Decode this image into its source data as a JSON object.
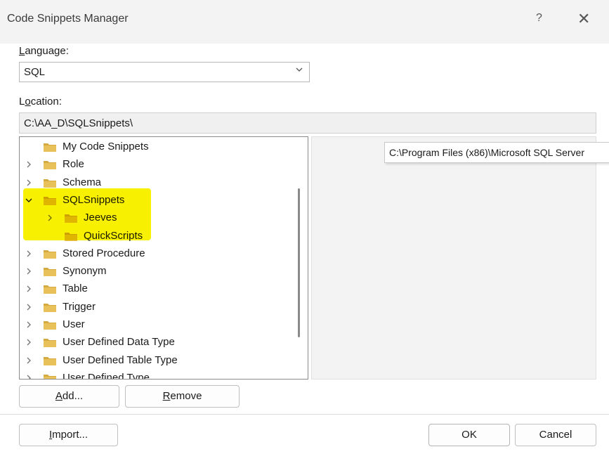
{
  "window": {
    "title": "Code Snippets Manager",
    "help": "?",
    "close": "✕"
  },
  "language": {
    "label": "Language:",
    "mnemonic": "L",
    "rest": "anguage:",
    "value": "SQL"
  },
  "location": {
    "label": "Location:",
    "pre": "L",
    "mnemonic": "o",
    "rest": "cation:",
    "value": "C:\\AA_D\\SQLSnippets\\"
  },
  "tree": {
    "items": [
      {
        "label": "My Code Snippets",
        "level": 1,
        "arrow": "none"
      },
      {
        "label": "Role",
        "level": 1,
        "arrow": "right"
      },
      {
        "label": "Schema",
        "level": 1,
        "arrow": "right"
      },
      {
        "label": "SQLSnippets",
        "level": 1,
        "arrow": "down"
      },
      {
        "label": "Jeeves",
        "level": 2,
        "arrow": "right"
      },
      {
        "label": "QuickScripts",
        "level": 2,
        "arrow": "none"
      },
      {
        "label": "Stored Procedure",
        "level": 1,
        "arrow": "right"
      },
      {
        "label": "Synonym",
        "level": 1,
        "arrow": "right"
      },
      {
        "label": "Table",
        "level": 1,
        "arrow": "right"
      },
      {
        "label": "Trigger",
        "level": 1,
        "arrow": "right"
      },
      {
        "label": "User",
        "level": 1,
        "arrow": "right"
      },
      {
        "label": "User Defined Data Type",
        "level": 1,
        "arrow": "right"
      },
      {
        "label": "User Defined Table Type",
        "level": 1,
        "arrow": "right"
      },
      {
        "label": "User Defined Type",
        "level": 1,
        "arrow": "right"
      }
    ]
  },
  "tooltip": {
    "text": "C:\\Program Files (x86)\\Microsoft SQL Server"
  },
  "buttons": {
    "add": {
      "mnemonic": "A",
      "rest": "dd..."
    },
    "remove": {
      "mnemonic": "R",
      "rest": "emove"
    },
    "import": {
      "mnemonic": "I",
      "rest": "mport..."
    },
    "ok": "OK",
    "cancel": "Cancel"
  },
  "colors": {
    "highlight": "#f7f000",
    "folder": "#e8c15a",
    "folder_dark": "#d4a93f"
  }
}
